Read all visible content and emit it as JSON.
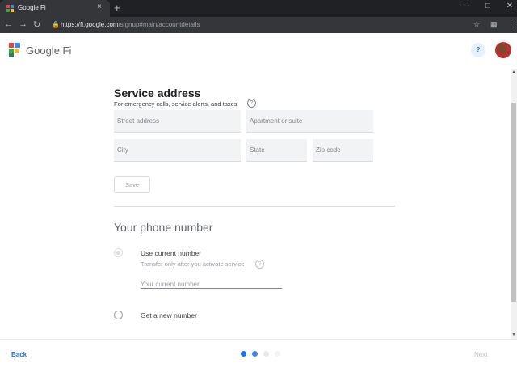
{
  "browser": {
    "tab_title": "Google Fi",
    "tab_close": "×",
    "new_tab": "+",
    "url_host": "https://fi.google.com",
    "url_path": "/signup#main/accountdetails"
  },
  "app": {
    "brand": "Google Fi",
    "help": "?"
  },
  "service_address": {
    "heading": "Service address",
    "description": "For emergency calls, service alerts, and taxes",
    "help": "?",
    "street_placeholder": "Street address",
    "apartment_placeholder": "Apartment or suite",
    "city_placeholder": "City",
    "state_placeholder": "State",
    "zip_placeholder": "Zip code",
    "save_label": "Save"
  },
  "phone_number": {
    "heading": "Your phone number",
    "option_current": "Use current number",
    "option_current_hint": "Transfer only after you activate service",
    "hint_help": "?",
    "current_placeholder": "Your current number",
    "option_new": "Get a new number"
  },
  "footer": {
    "back_label": "Back",
    "next_label": "Next",
    "steps": [
      {
        "state": "complete",
        "color": "#1a73e8"
      },
      {
        "state": "current",
        "color": "#4285f4"
      },
      {
        "state": "upcoming",
        "color": "#e8eaed"
      },
      {
        "state": "upcoming",
        "color": "#f1f3f4"
      }
    ]
  },
  "colors": {
    "accent": "#1a73e8",
    "chrome_dark": "#202124",
    "field_bg": "#f1f3f4"
  }
}
